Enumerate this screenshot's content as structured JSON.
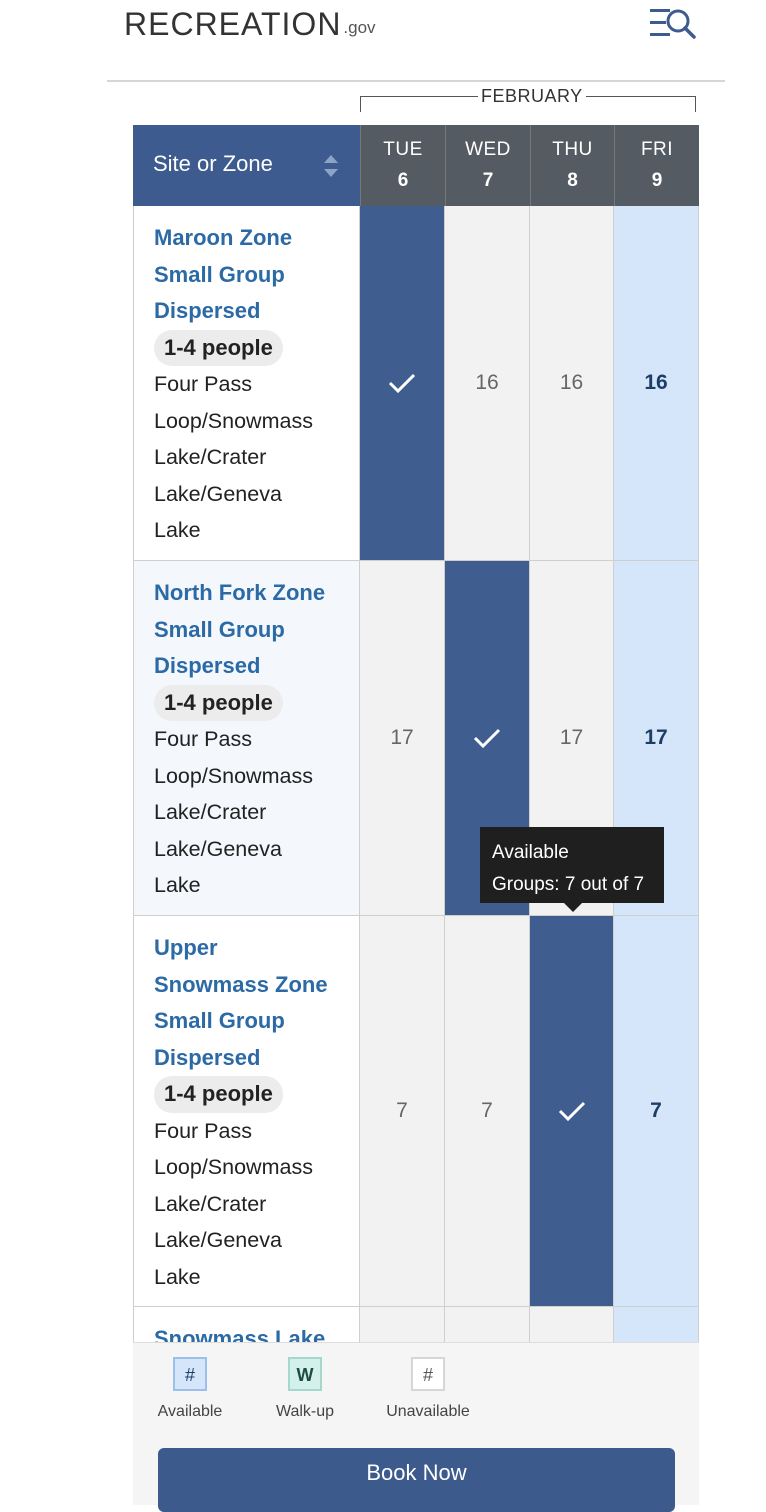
{
  "header": {
    "logo_main": "RECREATION",
    "logo_suffix": ".gov",
    "menu_icon": "menu-search-icon"
  },
  "calendar": {
    "month": "FEBRUARY",
    "site_column_label": "Site or Zone",
    "days": [
      {
        "dow": "TUE",
        "num": "6"
      },
      {
        "dow": "WED",
        "num": "7"
      },
      {
        "dow": "THU",
        "num": "8"
      },
      {
        "dow": "FRI",
        "num": "9"
      }
    ],
    "rows": [
      {
        "name": [
          "Maroon Zone",
          "Small Group",
          "Dispersed"
        ],
        "people": "1-4 people",
        "location": [
          "Four Pass",
          "Loop/Snowmass",
          "Lake/Crater",
          "Lake/Geneva",
          "Lake"
        ],
        "cells": [
          {
            "value": "✓",
            "state": "selected"
          },
          {
            "value": "16",
            "state": "unavailable"
          },
          {
            "value": "16",
            "state": "unavailable"
          },
          {
            "value": "16",
            "state": "available"
          }
        ]
      },
      {
        "name": [
          "North Fork Zone",
          "Small Group",
          "Dispersed"
        ],
        "people": "1-4 people",
        "location": [
          "Four Pass",
          "Loop/Snowmass",
          "Lake/Crater",
          "Lake/Geneva",
          "Lake"
        ],
        "cells": [
          {
            "value": "17",
            "state": "unavailable"
          },
          {
            "value": "✓",
            "state": "selected"
          },
          {
            "value": "17",
            "state": "unavailable"
          },
          {
            "value": "17",
            "state": "available"
          }
        ]
      },
      {
        "name": [
          "Upper",
          "Snowmass Zone",
          "Small Group",
          "Dispersed"
        ],
        "people": "1-4 people",
        "location": [
          "Four Pass",
          "Loop/Snowmass",
          "Lake/Crater",
          "Lake/Geneva",
          "Lake"
        ],
        "cells": [
          {
            "value": "7",
            "state": "unavailable"
          },
          {
            "value": "7",
            "state": "unavailable"
          },
          {
            "value": "✓",
            "state": "selected"
          },
          {
            "value": "7",
            "state": "available"
          }
        ]
      },
      {
        "name": [
          "Snowmass Lake"
        ],
        "people": "",
        "location": [],
        "cells": [
          {
            "value": "",
            "state": "unavailable"
          },
          {
            "value": "",
            "state": "unavailable"
          },
          {
            "value": "",
            "state": "unavailable"
          },
          {
            "value": "",
            "state": "available"
          }
        ]
      }
    ],
    "tooltip": {
      "line1": "Available",
      "line2": "Groups: 7 out of 7"
    }
  },
  "legend": {
    "items": [
      {
        "symbol": "#",
        "label": "Available"
      },
      {
        "symbol": "W",
        "label": "Walk-up"
      },
      {
        "symbol": "#",
        "label": "Unavailable"
      }
    ]
  },
  "actions": {
    "book_now": "Book Now"
  },
  "colors": {
    "brand_blue": "#3d5b8e",
    "available": "#d5e6fb",
    "link": "#2c6aa6",
    "header_gray": "#555b63"
  }
}
